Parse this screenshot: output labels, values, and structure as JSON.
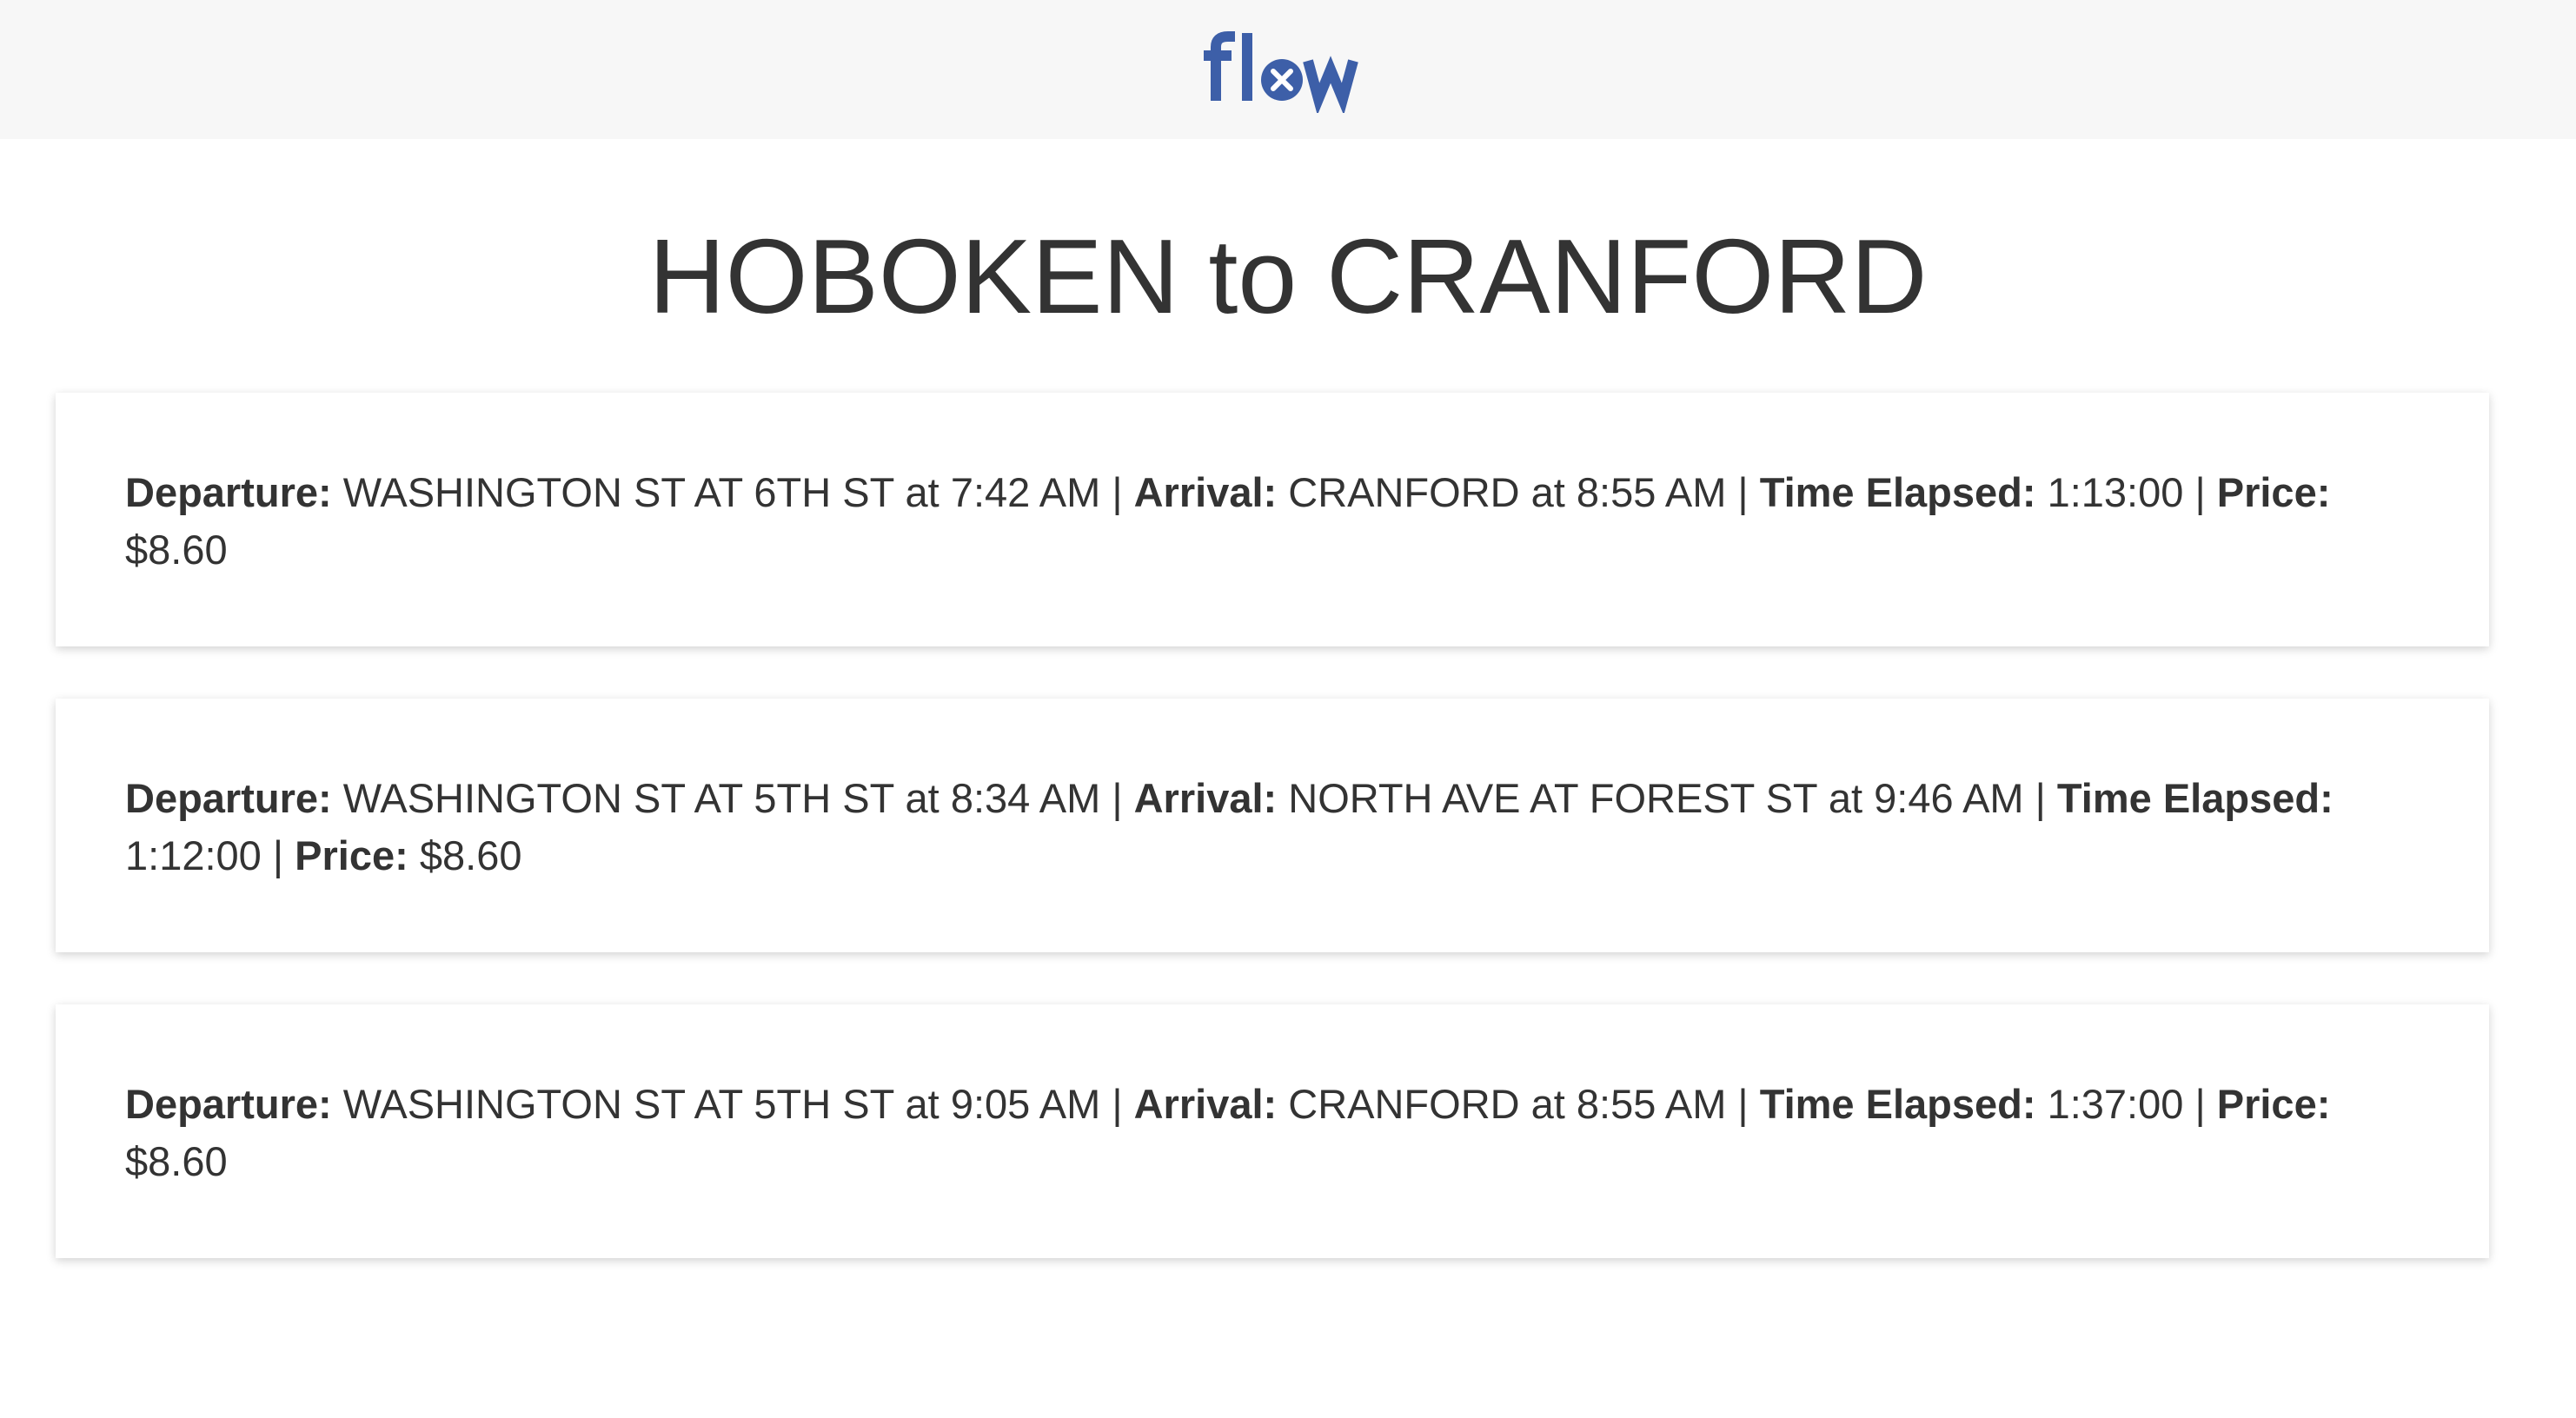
{
  "header": {
    "logo_text": "flow",
    "logo_color": "#3d5fa8"
  },
  "page": {
    "title": "HOBOKEN to CRANFORD"
  },
  "labels": {
    "departure": "Departure:",
    "arrival": "Arrival:",
    "elapsed": "Time Elapsed:",
    "price": "Price:",
    "at": "at",
    "separator": "|"
  },
  "trips": [
    {
      "departure_stop": "WASHINGTON ST AT 6TH ST",
      "departure_time": "7:42 AM",
      "arrival_stop": "CRANFORD",
      "arrival_time": "8:55 AM",
      "elapsed": "1:13:00",
      "price": "$8.60"
    },
    {
      "departure_stop": "WASHINGTON ST AT 5TH ST",
      "departure_time": "8:34 AM",
      "arrival_stop": "NORTH AVE AT FOREST ST",
      "arrival_time": "9:46 AM",
      "elapsed": "1:12:00",
      "price": "$8.60"
    },
    {
      "departure_stop": "WASHINGTON ST AT 5TH ST",
      "departure_time": "9:05 AM",
      "arrival_stop": "CRANFORD",
      "arrival_time": "8:55 AM",
      "elapsed": "1:37:00",
      "price": "$8.60"
    }
  ]
}
